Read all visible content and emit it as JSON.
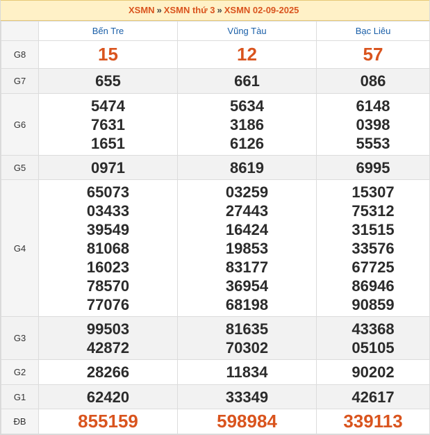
{
  "breadcrumb": {
    "item1": "XSMN",
    "item2": "XSMN thứ 3",
    "item3": "XSMN 02-09-2025",
    "separator": "»"
  },
  "provinces": [
    "Bến Tre",
    "Vũng Tàu",
    "Bạc Liêu"
  ],
  "prizes": {
    "g8": {
      "label": "G8",
      "values": [
        "15",
        "12",
        "57"
      ]
    },
    "g7": {
      "label": "G7",
      "values": [
        "655",
        "661",
        "086"
      ]
    },
    "g6": {
      "label": "G6",
      "values": [
        [
          "5474",
          "7631",
          "1651"
        ],
        [
          "5634",
          "3186",
          "6126"
        ],
        [
          "6148",
          "0398",
          "5553"
        ]
      ]
    },
    "g5": {
      "label": "G5",
      "values": [
        "0971",
        "8619",
        "6995"
      ]
    },
    "g4": {
      "label": "G4",
      "values": [
        [
          "65073",
          "03433",
          "39549",
          "81068",
          "16023",
          "78570",
          "77076"
        ],
        [
          "03259",
          "27443",
          "16424",
          "19853",
          "83177",
          "36954",
          "68198"
        ],
        [
          "15307",
          "75312",
          "31515",
          "33576",
          "67725",
          "86946",
          "90859"
        ]
      ]
    },
    "g3": {
      "label": "G3",
      "values": [
        [
          "99503",
          "42872"
        ],
        [
          "81635",
          "70302"
        ],
        [
          "43368",
          "05105"
        ]
      ]
    },
    "g2": {
      "label": "G2",
      "values": [
        "28266",
        "11834",
        "90202"
      ]
    },
    "g1": {
      "label": "G1",
      "values": [
        "62420",
        "33349",
        "42617"
      ]
    },
    "db": {
      "label": "ĐB",
      "values": [
        "855159",
        "598984",
        "339113"
      ]
    }
  },
  "colors": {
    "accent": "#d9541e",
    "header_bg": "#fff1c7",
    "province_text": "#1a5fa8",
    "number_text": "#2b2b2b"
  }
}
